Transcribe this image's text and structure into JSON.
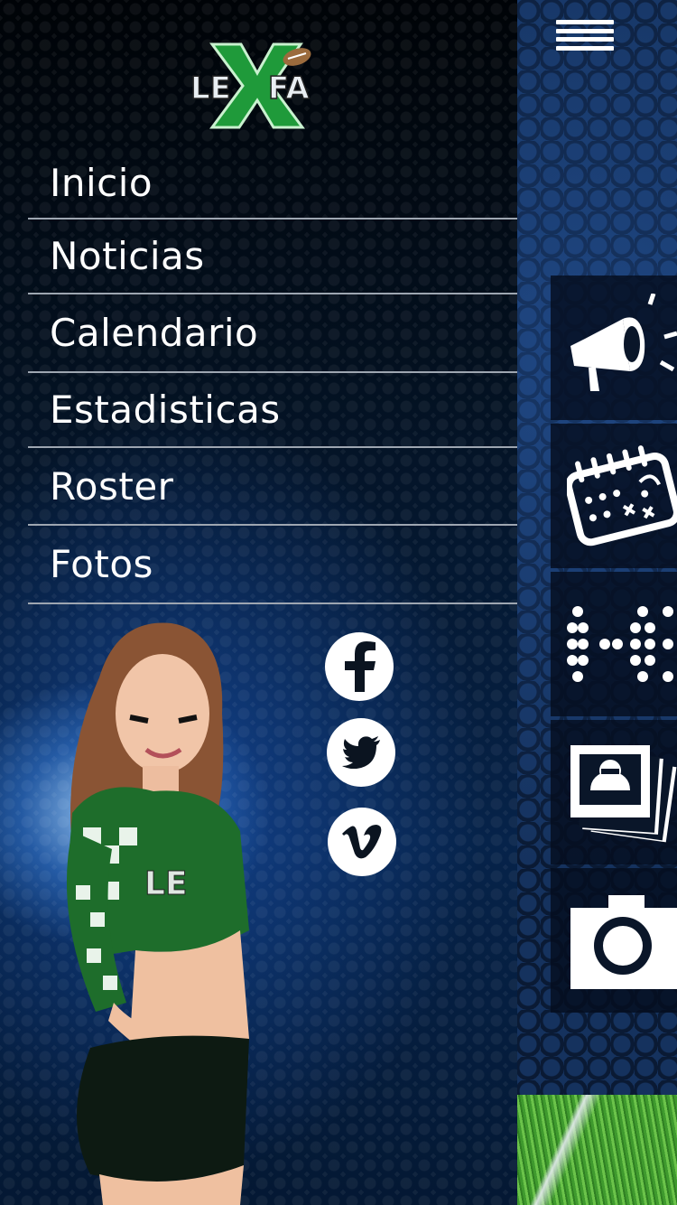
{
  "drawer": {
    "logo_text": "LEXFA",
    "menu": [
      {
        "label": "Inicio"
      },
      {
        "label": "Noticias"
      },
      {
        "label": "Calendario"
      },
      {
        "label": "Estadisticas"
      },
      {
        "label": "Roster"
      },
      {
        "label": "Fotos"
      }
    ],
    "social": [
      {
        "icon": "facebook-icon"
      },
      {
        "icon": "twitter-icon"
      },
      {
        "icon": "vimeo-icon"
      }
    ]
  },
  "main": {
    "menu_icon": "hamburger-icon",
    "tiles": [
      {
        "icon": "megaphone-icon"
      },
      {
        "icon": "calendar-playbook-icon"
      },
      {
        "icon": "stats-scoreboard-icon"
      },
      {
        "icon": "roster-photos-icon"
      },
      {
        "icon": "camera-icon"
      }
    ]
  },
  "colors": {
    "accent_green": "#1f9a3a",
    "divider": "#9ea6b1",
    "text": "#ffffff"
  }
}
